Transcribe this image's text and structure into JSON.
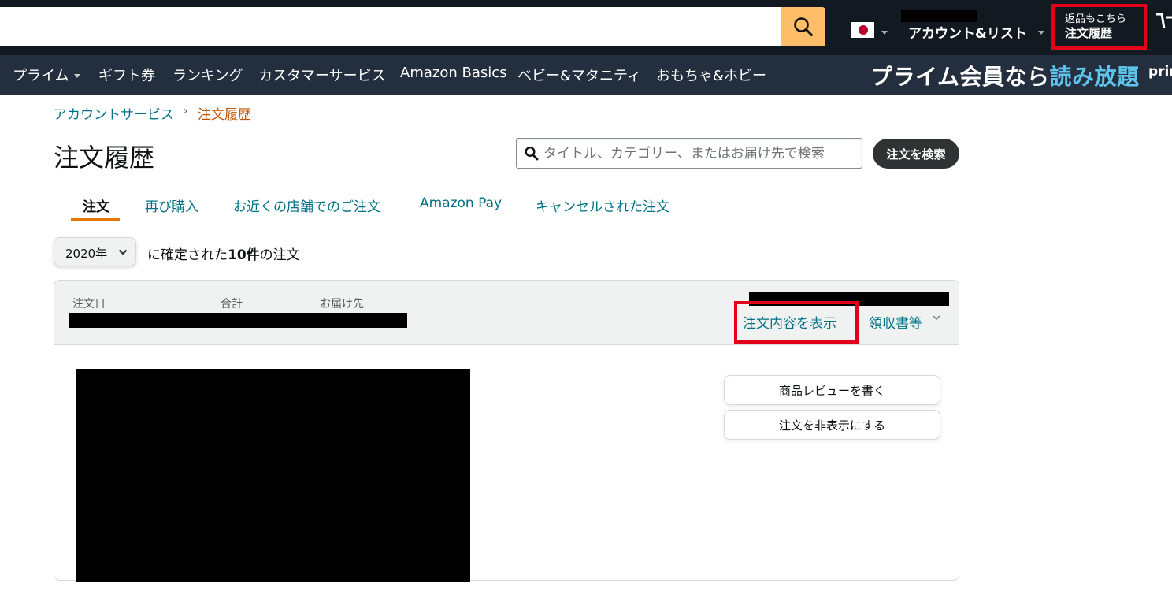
{
  "header": {
    "search": {
      "value": "",
      "placeholder": ""
    },
    "account_label": "アカウント&リスト",
    "orders_line1": "返品もこちら",
    "orders_line2": "注文履歴",
    "highlight_color": "#e3001b"
  },
  "subnav": {
    "items": [
      "プライム",
      "ギフト券",
      "ランキング",
      "カスタマーサービス",
      "Amazon Basics",
      "ベビー&マタニティ",
      "おもちゃ&ホビー"
    ],
    "promo_main": "プライム会員なら",
    "promo_highlight": "読み放題",
    "promo_tail": "prim"
  },
  "breadcrumb": {
    "parent": "アカウントサービス",
    "current": "注文履歴"
  },
  "page_title": "注文履歴",
  "order_search": {
    "placeholder": "タイトル、カテゴリー、またはお届け先で検索",
    "button": "注文を検索"
  },
  "tabs": [
    {
      "label": "注文",
      "active": true
    },
    {
      "label": "再び購入",
      "active": false
    },
    {
      "label": "お近くの店舗でのご注文",
      "active": false
    },
    {
      "label": "Amazon Pay",
      "active": false
    },
    {
      "label": "キャンセルされた注文",
      "active": false
    }
  ],
  "filter": {
    "year": "2020年",
    "summary_prefix": "に確定された",
    "count": "10件",
    "summary_suffix": "の注文"
  },
  "order": {
    "labels": {
      "date": "注文日",
      "total": "合計",
      "ship_to": "お届け先"
    },
    "view_details": "注文内容を表示",
    "receipt": "領収書等",
    "buttons": {
      "review": "商品レビューを書く",
      "hide": "注文を非表示にする"
    }
  },
  "colors": {
    "nav_top": "#131921",
    "nav_bottom": "#232f3e",
    "link": "#007185",
    "accent": "#e77600",
    "search_button": "#febd69"
  }
}
